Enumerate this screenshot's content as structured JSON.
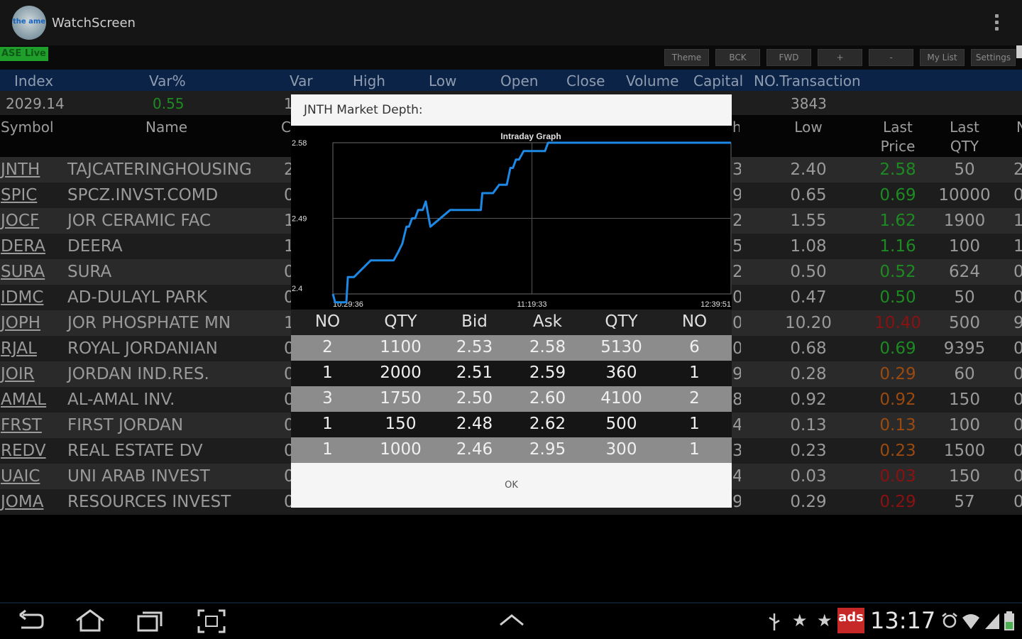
{
  "app": {
    "title": "WatchScreen",
    "logo_text": "the ame"
  },
  "toolbar": {
    "live_label": "ASE Live",
    "buttons": [
      "Theme",
      "BCK",
      "FWD",
      "+",
      "-",
      "My List",
      "Settings"
    ]
  },
  "index_header": [
    "Index",
    "Var%",
    "Var",
    "High",
    "Low",
    "Open",
    "Close",
    "Volume",
    "Capital",
    "NO.Transaction"
  ],
  "index_values": {
    "index": "2029.14",
    "var_pct": "0.55",
    "var_partial": "1",
    "no_transaction": "3843"
  },
  "table_header": {
    "symbol": "Symbol",
    "name": "Name",
    "partial_left": "C",
    "partial_right": "h",
    "low": "Low",
    "last_price": "Last\nPrice",
    "last_qty": "Last\nQTY",
    "partial_edge": "N"
  },
  "stocks": [
    {
      "symbol": "JNTH",
      "name": "TAJCATERINGHOUSING",
      "c": "2",
      "r": "3",
      "low": "2.40",
      "last_price": "2.58",
      "last_qty": "50",
      "e": "2",
      "color": "#1e8a22"
    },
    {
      "symbol": "SPIC",
      "name": "SPCZ.INVST.COMD",
      "c": "0",
      "r": "9",
      "low": "0.65",
      "last_price": "0.69",
      "last_qty": "10000",
      "e": "0",
      "color": "#1e8a22"
    },
    {
      "symbol": "JOCF",
      "name": "JOR CERAMIC FAC",
      "c": "1",
      "r": "2",
      "low": "1.55",
      "last_price": "1.62",
      "last_qty": "1900",
      "e": "1",
      "color": "#1e8a22"
    },
    {
      "symbol": "DERA",
      "name": "DEERA",
      "c": "1",
      "r": "5",
      "low": "1.08",
      "last_price": "1.16",
      "last_qty": "100",
      "e": "1",
      "color": "#1e8a22"
    },
    {
      "symbol": "SURA",
      "name": "SURA",
      "c": "0",
      "r": "2",
      "low": "0.50",
      "last_price": "0.52",
      "last_qty": "624",
      "e": "0",
      "color": "#1e8a22"
    },
    {
      "symbol": "IDMC",
      "name": "AD-DULAYL PARK",
      "c": "0",
      "r": "0",
      "low": "0.47",
      "last_price": "0.50",
      "last_qty": "50",
      "e": "0",
      "color": "#1e8a22"
    },
    {
      "symbol": "JOPH",
      "name": "JOR PHOSPHATE MN",
      "c": "1",
      "r": "0",
      "low": "10.20",
      "last_price": "10.40",
      "last_qty": "500",
      "e": "9",
      "color": "#8b1111"
    },
    {
      "symbol": "RJAL",
      "name": "ROYAL JORDANIAN",
      "c": "0",
      "r": "0",
      "low": "0.68",
      "last_price": "0.69",
      "last_qty": "9395",
      "e": "0",
      "color": "#1e8a22"
    },
    {
      "symbol": "JOIR",
      "name": "JORDAN IND.RES.",
      "c": "0",
      "r": "9",
      "low": "0.28",
      "last_price": "0.29",
      "last_qty": "60",
      "e": "0",
      "color": "#9a4a10"
    },
    {
      "symbol": "AMAL",
      "name": "AL-AMAL INV.",
      "c": "0",
      "r": "8",
      "low": "0.92",
      "last_price": "0.92",
      "last_qty": "150",
      "e": "0",
      "color": "#9a4a10"
    },
    {
      "symbol": "FRST",
      "name": "FIRST JORDAN",
      "c": "0",
      "r": "4",
      "low": "0.13",
      "last_price": "0.13",
      "last_qty": "100",
      "e": "0",
      "color": "#9a4a10"
    },
    {
      "symbol": "REDV",
      "name": "REAL ESTATE DV",
      "c": "0",
      "r": "3",
      "low": "0.23",
      "last_price": "0.23",
      "last_qty": "1500",
      "e": "0",
      "color": "#9a4a10"
    },
    {
      "symbol": "UAIC",
      "name": "UNI ARAB INVEST",
      "c": "0",
      "r": "4",
      "low": "0.03",
      "last_price": "0.03",
      "last_qty": "150",
      "e": "0",
      "color": "#8b1111"
    },
    {
      "symbol": "JOMA",
      "name": "RESOURCES INVEST",
      "c": "0",
      "r": "9",
      "low": "0.29",
      "last_price": "0.29",
      "last_qty": "57",
      "e": "0",
      "color": "#8b1111"
    }
  ],
  "dialog": {
    "title": "JNTH Market Depth:",
    "ok_label": "OK",
    "depth_header": [
      "NO",
      "QTY",
      "Bid",
      "Ask",
      "QTY",
      "NO"
    ],
    "depth_rows": [
      [
        "2",
        "1100",
        "2.53",
        "2.58",
        "5130",
        "6"
      ],
      [
        "1",
        "2000",
        "2.51",
        "2.59",
        "360",
        "1"
      ],
      [
        "3",
        "1750",
        "2.50",
        "2.60",
        "4100",
        "2"
      ],
      [
        "1",
        "150",
        "2.48",
        "2.62",
        "500",
        "1"
      ],
      [
        "1",
        "1000",
        "2.46",
        "2.95",
        "300",
        "1"
      ]
    ]
  },
  "chart_data": {
    "type": "line",
    "title": "Intraday Graph",
    "xlabel": "",
    "ylabel": "",
    "ylim": [
      2.4,
      2.58
    ],
    "y_ticks": [
      "2.58",
      "2.49",
      "2.4"
    ],
    "x_ticks": [
      "10:29:36",
      "11:19:33",
      "12:39:51"
    ],
    "line_color": "#1e88e5",
    "grid": true,
    "series": [
      {
        "x": [
          "10:29:36",
          "10:30:20",
          "10:31:10",
          "10:31:40",
          "10:33:30",
          "10:34:00",
          "10:34:30",
          "10:36:30",
          "10:42:00",
          "10:44:00",
          "10:49:30",
          "10:51:00",
          "10:52:20",
          "10:53:40",
          "10:54:30",
          "10:55:30",
          "10:56:30",
          "10:57:30",
          "10:58:20",
          "10:59:00",
          "11:00:00",
          "11:01:30",
          "11:08:00",
          "11:09:00",
          "11:18:00",
          "11:18:30",
          "11:19:33",
          "11:20:20",
          "11:22:00",
          "11:24:00",
          "11:26:30",
          "11:27:40",
          "11:28:30",
          "11:29:30",
          "11:30:30",
          "11:32:00",
          "11:37:30",
          "11:39:00",
          "11:40:00",
          "12:39:51"
        ],
        "y": [
          2.4,
          2.39,
          2.39,
          2.39,
          2.39,
          2.39,
          2.42,
          2.42,
          2.44,
          2.44,
          2.44,
          2.45,
          2.46,
          2.48,
          2.48,
          2.49,
          2.49,
          2.5,
          2.5,
          2.5,
          2.51,
          2.48,
          2.5,
          2.5,
          2.5,
          2.52,
          2.52,
          2.52,
          2.52,
          2.53,
          2.53,
          2.55,
          2.55,
          2.56,
          2.56,
          2.57,
          2.57,
          2.57,
          2.58,
          2.58
        ]
      }
    ]
  },
  "status_bar": {
    "clock": "13:17",
    "ads_label": "ads"
  }
}
